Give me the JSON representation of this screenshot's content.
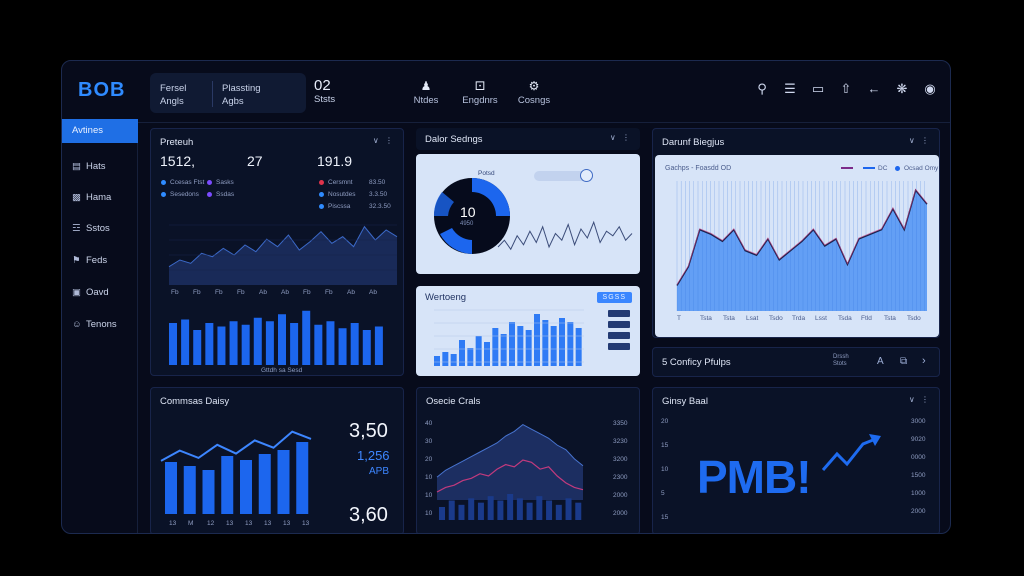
{
  "header": {
    "logo": "BOB",
    "pill_a_line1": "Fersel",
    "pill_a_line2": "Angls",
    "pill_b_line1": "Plassting",
    "pill_b_line2": "Agbs",
    "stat_value": "02",
    "stat_label": "Ststs",
    "nav": [
      {
        "label": "Ntdes",
        "icon": "person-icon"
      },
      {
        "label": "Engdnrs",
        "icon": "dice-icon"
      },
      {
        "label": "Cosngs",
        "icon": "gear-icon"
      }
    ]
  },
  "sidebar": {
    "items": [
      {
        "label": "Avtines",
        "icon": ""
      },
      {
        "label": "Hats",
        "icon": "chart-icon"
      },
      {
        "label": "Hama",
        "icon": "document-icon"
      },
      {
        "label": "Sstos",
        "icon": "list-icon"
      },
      {
        "label": "Feds",
        "icon": "tag-icon"
      },
      {
        "label": "Oavd",
        "icon": "calendar-icon"
      },
      {
        "label": "Tenons",
        "icon": "settings-icon"
      }
    ]
  },
  "panel1": {
    "title": "Preteuh",
    "stats": [
      "1512,",
      "27",
      "191.9"
    ],
    "legend_left": [
      "Ccesas Ftst",
      "Sesedons"
    ],
    "legend_right": [
      "Cersmnt",
      "Nosutdes",
      "Piscssa"
    ],
    "legend_left_b": [
      "Sasks",
      "Ssdas"
    ],
    "legend_right_vals": [
      "83.50",
      "3.3.50",
      "32.3.50"
    ],
    "x_ticks": [
      "Fb",
      "Fb",
      "Fb",
      "Fb",
      "Ab",
      "Ab",
      "Fb",
      "Fb",
      "Ab",
      "Ab"
    ],
    "caption": "Gttdh sa Sesd",
    "area_series": [
      22,
      30,
      26,
      38,
      34,
      44,
      36,
      48,
      40,
      55,
      46,
      60,
      42,
      52,
      64,
      50,
      58,
      46,
      70,
      54,
      66,
      58
    ],
    "bar_values": [
      48,
      52,
      40,
      48,
      44,
      50,
      46,
      54,
      50,
      58,
      48,
      62,
      46,
      50,
      42,
      48,
      40,
      44
    ]
  },
  "panel2": {
    "title": "Dalor Sedngs",
    "donut_value": "10",
    "donut_sub": "4950",
    "donut_label": "Potsd",
    "wave_series": [
      8,
      14,
      6,
      18,
      10,
      22,
      12,
      26,
      8,
      20,
      14,
      28,
      10,
      24,
      16,
      30,
      12,
      22,
      18,
      26,
      14,
      20
    ]
  },
  "panel3": {
    "title": "Wertoeng",
    "badge": "SGSS",
    "bar_values": [
      10,
      14,
      12,
      26,
      18,
      30,
      24,
      38,
      32,
      44,
      40,
      36,
      52,
      46,
      40,
      48,
      44,
      38
    ],
    "legend": [
      "",
      "",
      "",
      ""
    ]
  },
  "panel4": {
    "title": "Darunf Biegjus",
    "subtitle": "Gachps - Foasdd OD",
    "legend": [
      "DC",
      "Ocsad Omy"
    ],
    "x_ticks": [
      "T",
      "Tsta",
      "Tsta",
      "Lsat",
      "Tsdo",
      "Trda",
      "Lsst",
      "Tsda",
      "Ftld",
      "Tsta",
      "Tsdo"
    ],
    "series": [
      22,
      38,
      70,
      66,
      60,
      70,
      52,
      48,
      62,
      44,
      52,
      60,
      70,
      56,
      62,
      40,
      62,
      66,
      70,
      88,
      70,
      104,
      92
    ]
  },
  "strip": {
    "title": "5 Conficy Pfulps",
    "buttons": [
      "Drssh Stots",
      "A",
      "⧉",
      "›"
    ]
  },
  "panel5": {
    "title": "Commsas Daisy",
    "value_a": "3,50",
    "value_b": "1,256",
    "value_b_label": "APB",
    "value_c": "3,60",
    "x_ticks": [
      "13",
      "M",
      "12",
      "13",
      "13",
      "13",
      "13",
      "13"
    ],
    "bar_values": [
      52,
      48,
      44,
      58,
      54,
      60,
      64,
      72
    ],
    "trend": [
      40,
      54,
      44,
      62,
      50,
      68,
      58,
      80,
      70
    ]
  },
  "panel6": {
    "title": "Osecie Crals",
    "y_left": [
      "40",
      "30",
      "20",
      "10",
      "10",
      "10"
    ],
    "y_right": [
      "3350",
      "3230",
      "3200",
      "2300",
      "2000",
      "2000"
    ],
    "area_dark": [
      20,
      26,
      30,
      34,
      38,
      42,
      46,
      50,
      56,
      60,
      66,
      62,
      58,
      54,
      48,
      44,
      36,
      30
    ],
    "area_light": [
      14,
      18,
      20,
      24,
      26,
      30,
      28,
      34,
      38,
      36,
      42,
      40,
      34,
      36,
      28,
      22,
      18,
      16
    ],
    "bar_values": [
      12,
      18,
      14,
      20,
      16,
      22,
      18,
      24,
      20,
      16,
      22,
      18,
      14,
      20,
      16
    ]
  },
  "panel7": {
    "title": "Ginsy Baal",
    "big_text": "PMB!",
    "y_left": [
      "20",
      "15",
      "10",
      "5",
      "15"
    ],
    "y_right": [
      "3000",
      "9020",
      "0000",
      "1500",
      "1000",
      "2000"
    ]
  },
  "colors": {
    "accent": "#1f6fe5",
    "bar": "#1c66ee",
    "pink": "#d9387a",
    "bg": "#070b1b"
  }
}
